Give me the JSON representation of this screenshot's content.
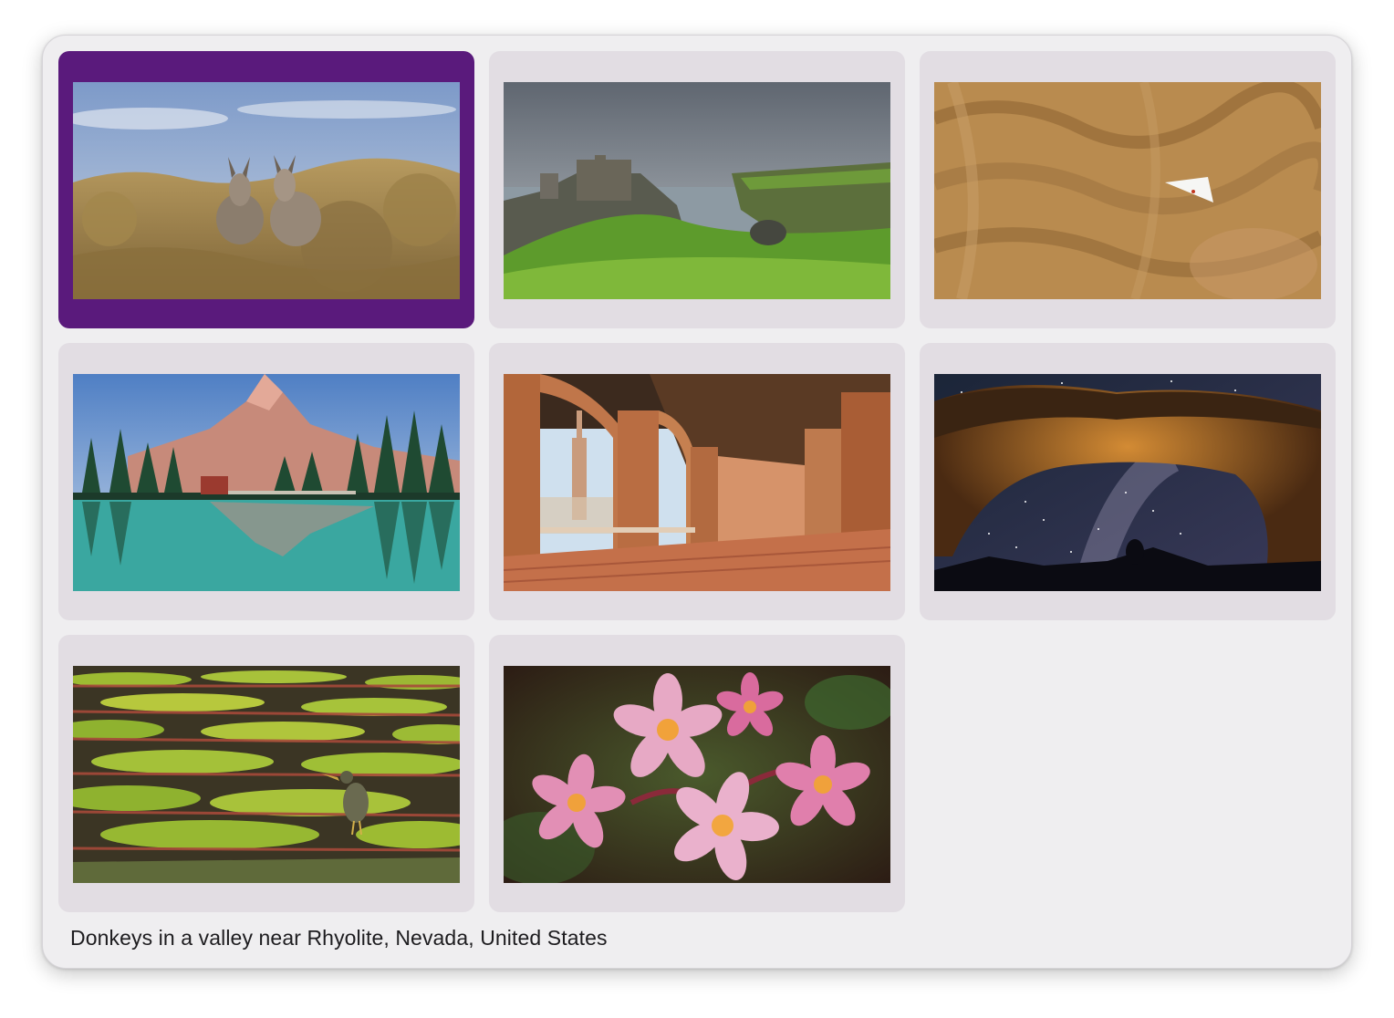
{
  "gallery": {
    "selected_index": 0,
    "items": [
      {
        "title": "Donkeys in a valley near Rhyolite, Nevada, United States",
        "icon": "image-donkeys"
      },
      {
        "title": "",
        "icon": "image-castle-cliffs"
      },
      {
        "title": "",
        "icon": "image-sand-dunes-hang-glider"
      },
      {
        "title": "",
        "icon": "image-mountain-lake"
      },
      {
        "title": "",
        "icon": "image-plaza-arcade"
      },
      {
        "title": "",
        "icon": "image-arch-milky-way"
      },
      {
        "title": "",
        "icon": "image-lily-pads-heron"
      },
      {
        "title": "",
        "icon": "image-plumeria-flowers"
      }
    ]
  },
  "caption": "Donkeys in a valley near Rhyolite, Nevada, United States",
  "colors": {
    "selection": "#5a1a7c",
    "tile_background": "#e2dde3",
    "window_background": "#efeef0"
  }
}
